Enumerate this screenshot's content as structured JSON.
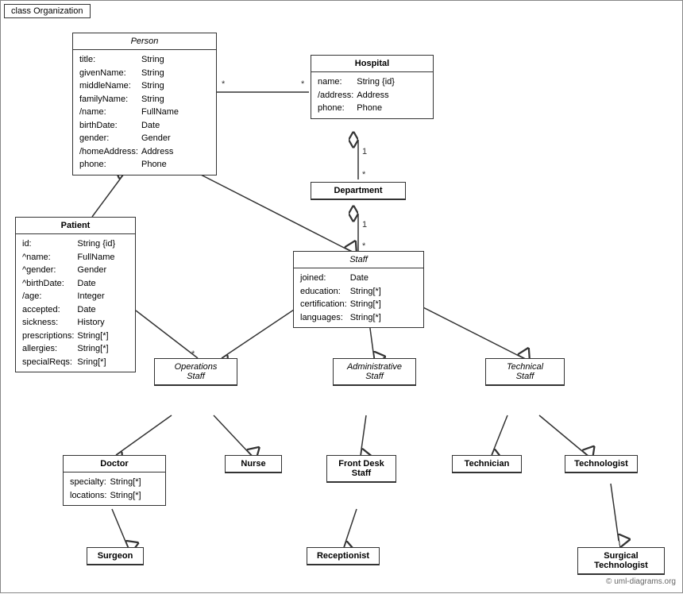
{
  "title": "class Organization",
  "watermark": "© uml-diagrams.org",
  "boxes": {
    "person": {
      "header": "Person",
      "attrs": [
        [
          "title:",
          "String"
        ],
        [
          "givenName:",
          "String"
        ],
        [
          "middleName:",
          "String"
        ],
        [
          "familyName:",
          "String"
        ],
        [
          "/name:",
          "FullName"
        ],
        [
          "birthDate:",
          "Date"
        ],
        [
          "gender:",
          "Gender"
        ],
        [
          "/homeAddress:",
          "Address"
        ],
        [
          "phone:",
          "Phone"
        ]
      ]
    },
    "hospital": {
      "header": "Hospital",
      "attrs": [
        [
          "name:",
          "String {id}"
        ],
        [
          "/address:",
          "Address"
        ],
        [
          "phone:",
          "Phone"
        ]
      ]
    },
    "department": {
      "header": "Department"
    },
    "staff": {
      "header": "Staff",
      "attrs": [
        [
          "joined:",
          "Date"
        ],
        [
          "education:",
          "String[*]"
        ],
        [
          "certification:",
          "String[*]"
        ],
        [
          "languages:",
          "String[*]"
        ]
      ]
    },
    "patient": {
      "header": "Patient",
      "attrs": [
        [
          "id:",
          "String {id}"
        ],
        [
          "^name:",
          "FullName"
        ],
        [
          "^gender:",
          "Gender"
        ],
        [
          "^birthDate:",
          "Date"
        ],
        [
          "/age:",
          "Integer"
        ],
        [
          "accepted:",
          "Date"
        ],
        [
          "sickness:",
          "History"
        ],
        [
          "prescriptions:",
          "String[*]"
        ],
        [
          "allergies:",
          "String[*]"
        ],
        [
          "specialReqs:",
          "Sring[*]"
        ]
      ]
    },
    "operationsStaff": {
      "header": "Operations\nStaff"
    },
    "administrativeStaff": {
      "header": "Administrative\nStaff"
    },
    "technicalStaff": {
      "header": "Technical\nStaff"
    },
    "doctor": {
      "header": "Doctor",
      "attrs": [
        [
          "specialty:",
          "String[*]"
        ],
        [
          "locations:",
          "String[*]"
        ]
      ]
    },
    "nurse": {
      "header": "Nurse"
    },
    "frontDeskStaff": {
      "header": "Front Desk\nStaff"
    },
    "technician": {
      "header": "Technician"
    },
    "technologist": {
      "header": "Technologist"
    },
    "surgeon": {
      "header": "Surgeon"
    },
    "receptionist": {
      "header": "Receptionist"
    },
    "surgicalTechnologist": {
      "header": "Surgical\nTechnologist"
    }
  }
}
